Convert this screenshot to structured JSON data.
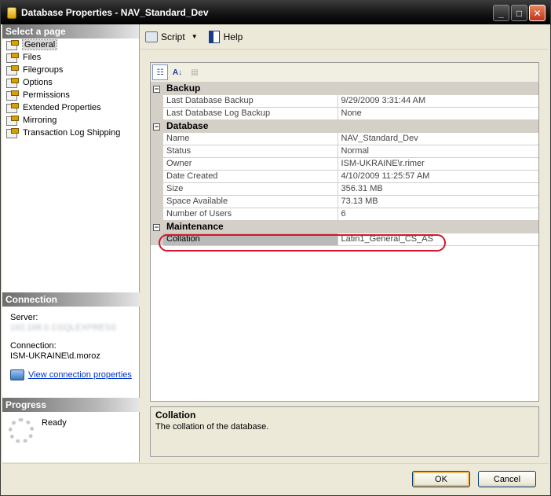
{
  "window": {
    "title": "Database Properties - NAV_Standard_Dev"
  },
  "left_pane": {
    "select_page_header": "Select a page",
    "pages": [
      {
        "label": "General",
        "selected": true
      },
      {
        "label": "Files",
        "selected": false
      },
      {
        "label": "Filegroups",
        "selected": false
      },
      {
        "label": "Options",
        "selected": false
      },
      {
        "label": "Permissions",
        "selected": false
      },
      {
        "label": "Extended Properties",
        "selected": false
      },
      {
        "label": "Mirroring",
        "selected": false
      },
      {
        "label": "Transaction Log Shipping",
        "selected": false
      }
    ],
    "connection_header": "Connection",
    "server_label": "Server:",
    "server_value": "192.168.0.1\\SQLEXPRESS",
    "connection_label": "Connection:",
    "connection_value": "ISM-UKRAINE\\d.moroz",
    "view_connection_link": "View connection properties",
    "progress_header": "Progress",
    "progress_status": "Ready"
  },
  "toolbar": {
    "script_label": "Script",
    "help_label": "Help"
  },
  "property_grid": {
    "categories": [
      {
        "name": "Backup",
        "properties": [
          {
            "name": "Last Database Backup",
            "value": "9/29/2009 3:31:44 AM"
          },
          {
            "name": "Last Database Log Backup",
            "value": "None"
          }
        ]
      },
      {
        "name": "Database",
        "properties": [
          {
            "name": "Name",
            "value": "NAV_Standard_Dev"
          },
          {
            "name": "Status",
            "value": "Normal"
          },
          {
            "name": "Owner",
            "value": "ISM-UKRAINE\\r.rimer"
          },
          {
            "name": "Date Created",
            "value": "4/10/2009 11:25:57 AM"
          },
          {
            "name": "Size",
            "value": "356.31 MB"
          },
          {
            "name": "Space Available",
            "value": "73.13 MB"
          },
          {
            "name": "Number of Users",
            "value": "6"
          }
        ]
      },
      {
        "name": "Maintenance",
        "properties": [
          {
            "name": "Collation",
            "value": "Latin1_General_CS_AS",
            "selected": true
          }
        ]
      }
    ]
  },
  "description": {
    "title": "Collation",
    "text": "The collation of the database."
  },
  "buttons": {
    "ok_label": "OK",
    "cancel_label": "Cancel"
  },
  "colors": {
    "highlight_ring": "#d2182a",
    "link": "#0033cc"
  }
}
